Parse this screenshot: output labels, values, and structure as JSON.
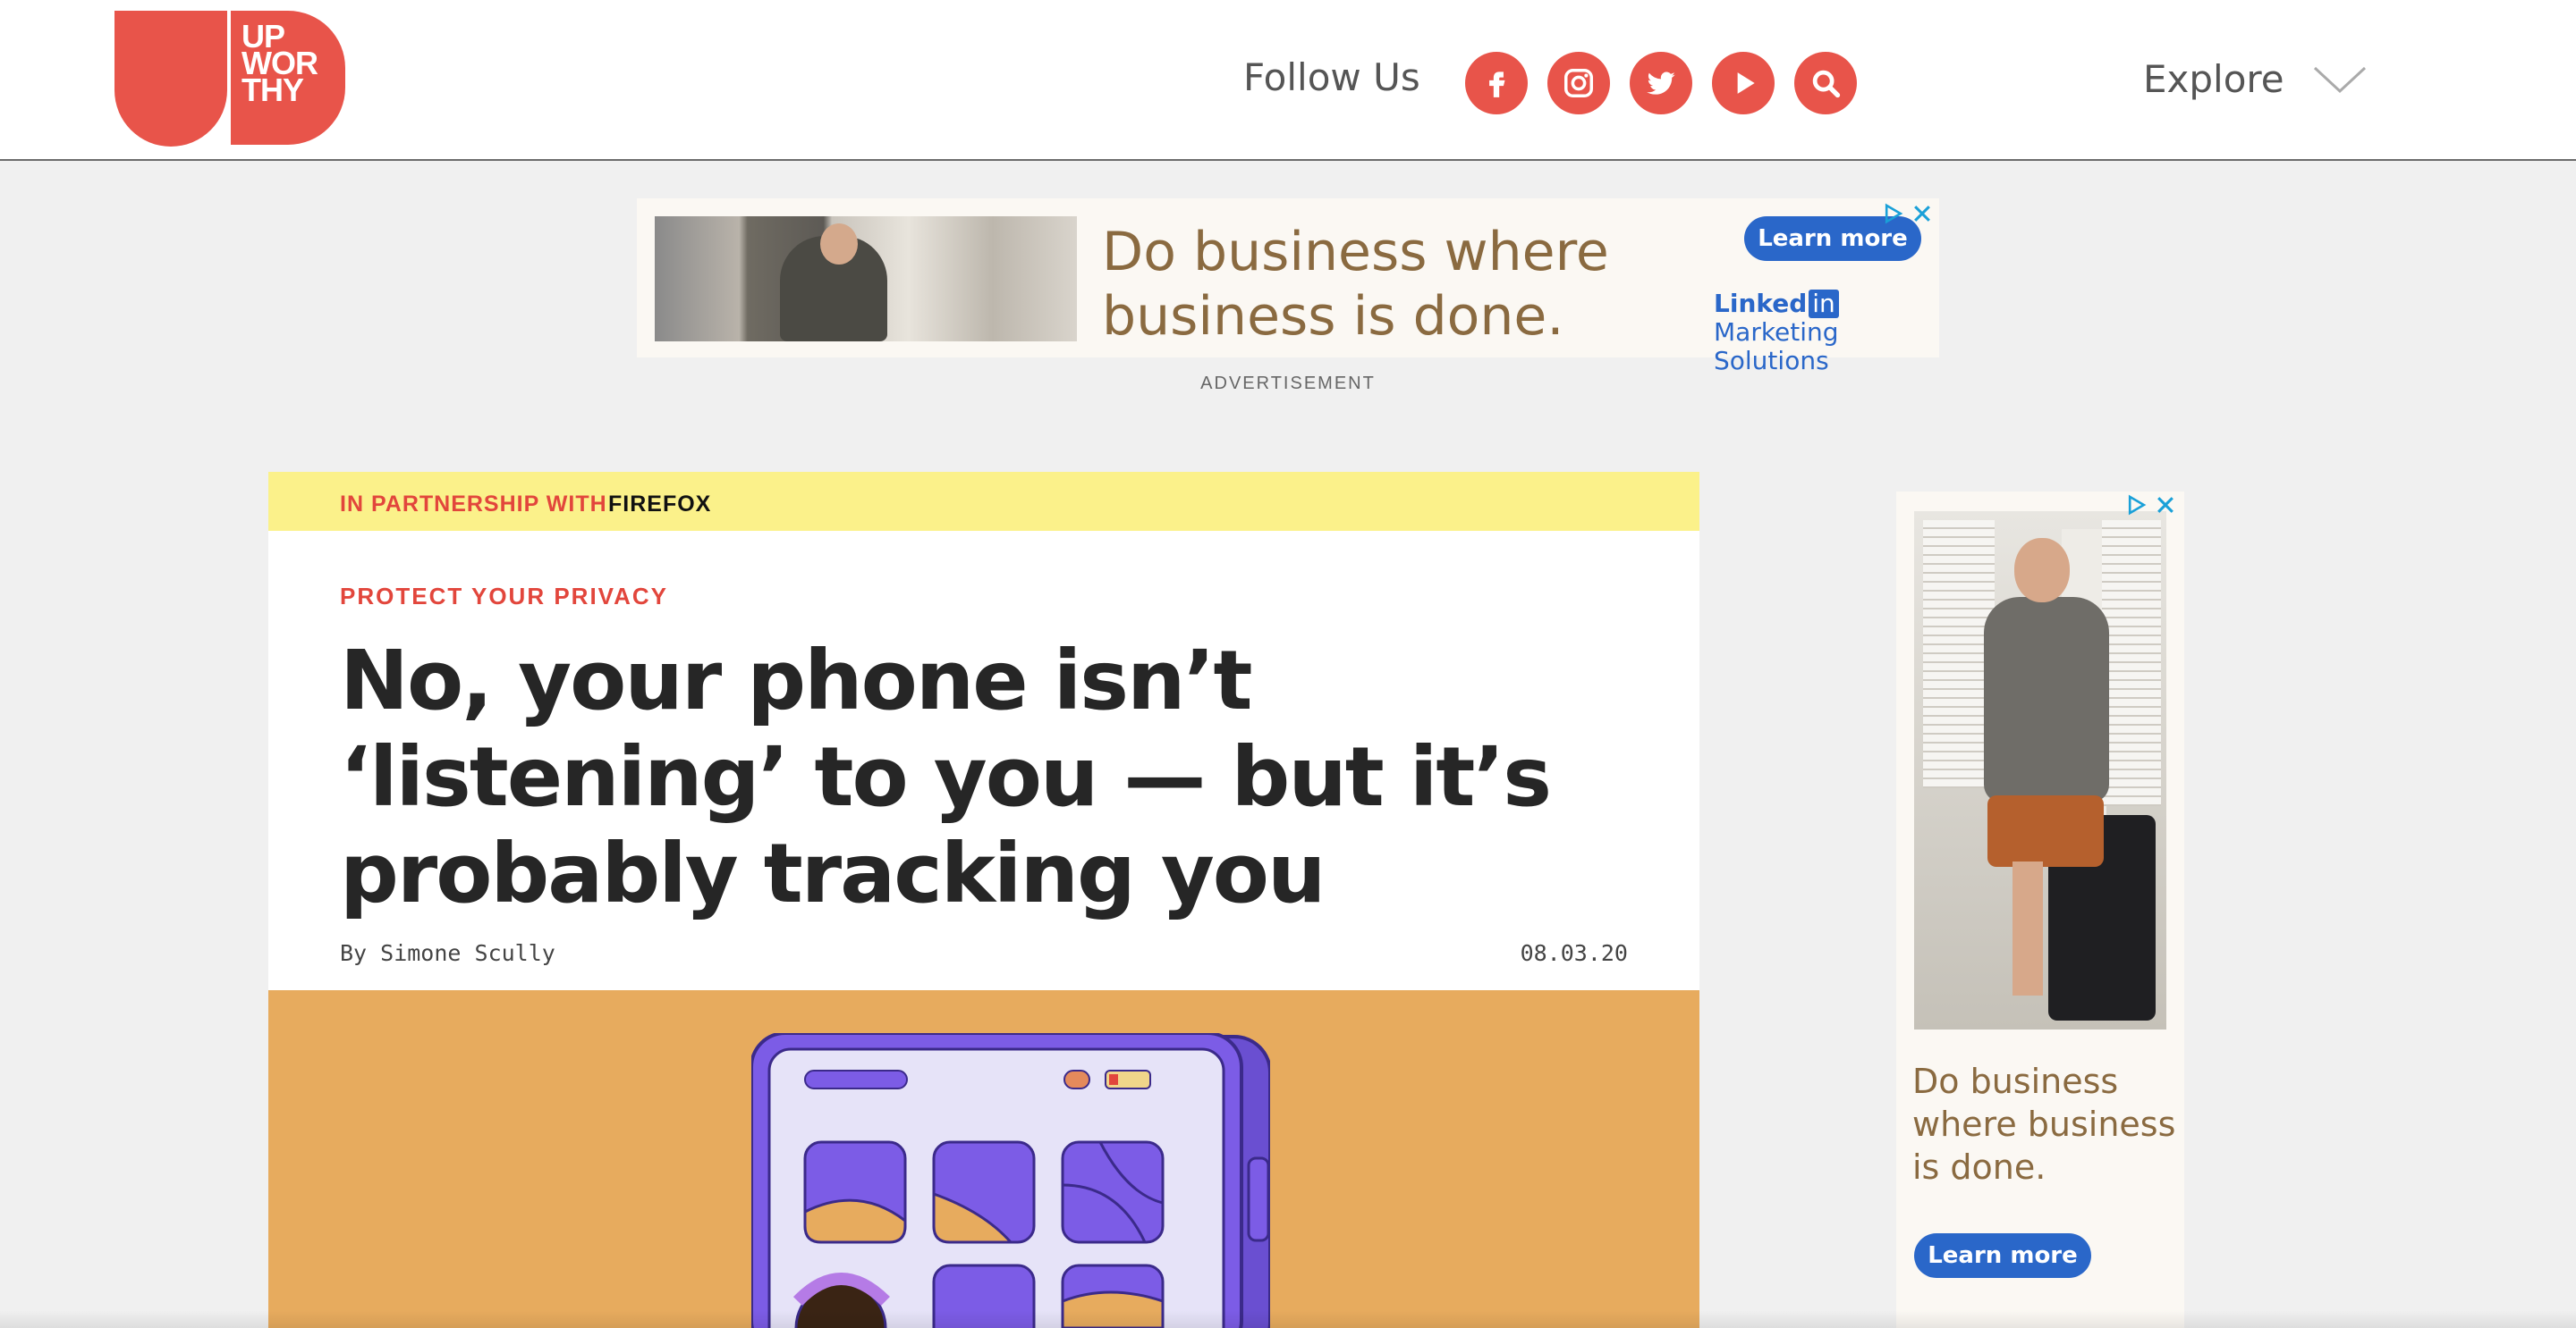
{
  "brand": {
    "logo_lines": [
      "UP",
      "WOR",
      "THY"
    ],
    "accent_color": "#e8544a"
  },
  "header": {
    "follow_label": "Follow Us",
    "social": [
      {
        "icon": "facebook-icon"
      },
      {
        "icon": "instagram-icon"
      },
      {
        "icon": "twitter-icon"
      },
      {
        "icon": "youtube-icon"
      },
      {
        "icon": "search-icon"
      }
    ],
    "explore_label": "Explore"
  },
  "top_ad": {
    "headline_lines": [
      "Do business where",
      "business is done."
    ],
    "cta": "Learn more",
    "brand": "Linked",
    "brand_badge": "in",
    "brand_sub": "Marketing Solutions",
    "label": "ADVERTISEMENT"
  },
  "article": {
    "partnership_prefix": "IN PARTNERSHIP WITH",
    "partner": "FIREFOX",
    "category": "PROTECT YOUR PRIVACY",
    "headline_lines": [
      "No, your phone isn’t",
      "‘listening’ to you — but it’s",
      "probably tracking you"
    ],
    "byline": "By Simone Scully",
    "date": "08.03.20",
    "hero_color": "#e7ab5e"
  },
  "side_ad": {
    "headline_lines": [
      "Do business",
      "where business",
      "is done."
    ],
    "cta": "Learn more"
  }
}
